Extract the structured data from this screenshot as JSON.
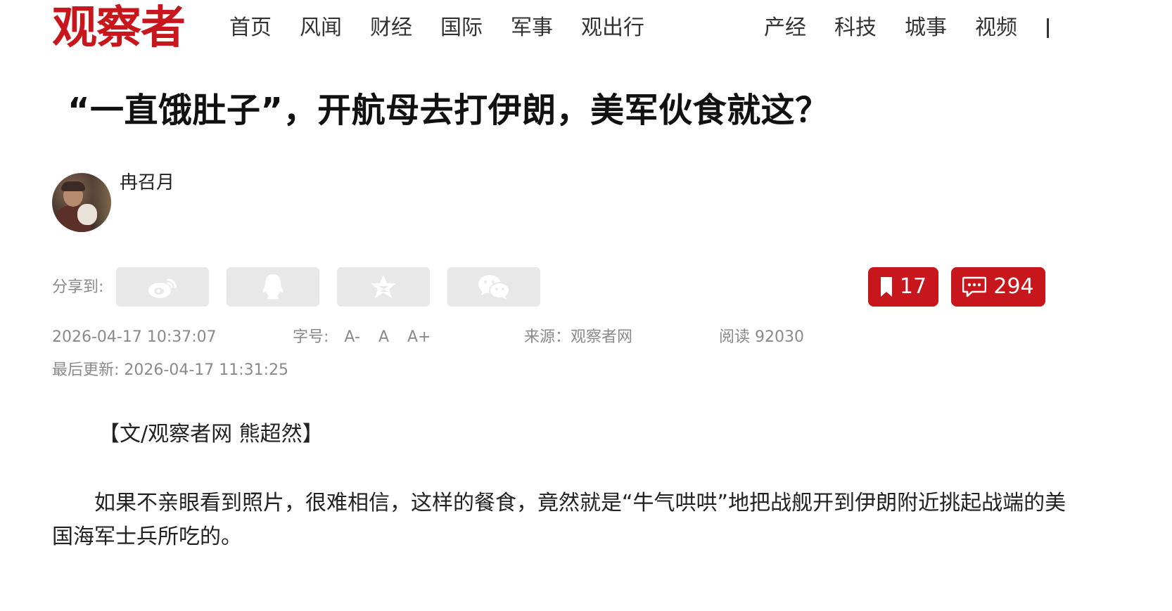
{
  "site": {
    "logo": "观察者"
  },
  "nav": {
    "left": [
      "首页",
      "风闻",
      "财经",
      "国际",
      "军事",
      "观出行"
    ],
    "right": [
      "产经",
      "科技",
      "城事",
      "视频"
    ]
  },
  "article": {
    "title": "“一直饿肚子”，开航母去打伊朗，美军伙食就这？",
    "author": "冉召月",
    "share_label": "分享到:",
    "share_icons": [
      "weibo-icon",
      "qq-icon",
      "qzone-icon",
      "wechat-icon"
    ],
    "bookmark_count": "17",
    "comment_count": "294",
    "publish_time": "2026-04-17 10:37:07",
    "font_size_label": "字号:",
    "font_sizes": [
      "A-",
      "A",
      "A+"
    ],
    "source": "来源：观察者网",
    "reads": "阅读 92030",
    "last_updated": "最后更新: 2026-04-17 11:31:25",
    "byline": "【文/观察者网 熊超然】",
    "paragraph": "如果不亲眼看到照片，很难相信，这样的餐食，竟然就是“牛气哄哄”地把战舰开到伊朗附近挑起战端的美国海军士兵所吃的。"
  },
  "colors": {
    "brand_red": "#c8161d",
    "muted_text": "#8a8a8a",
    "share_bg": "#e8e8e8"
  }
}
